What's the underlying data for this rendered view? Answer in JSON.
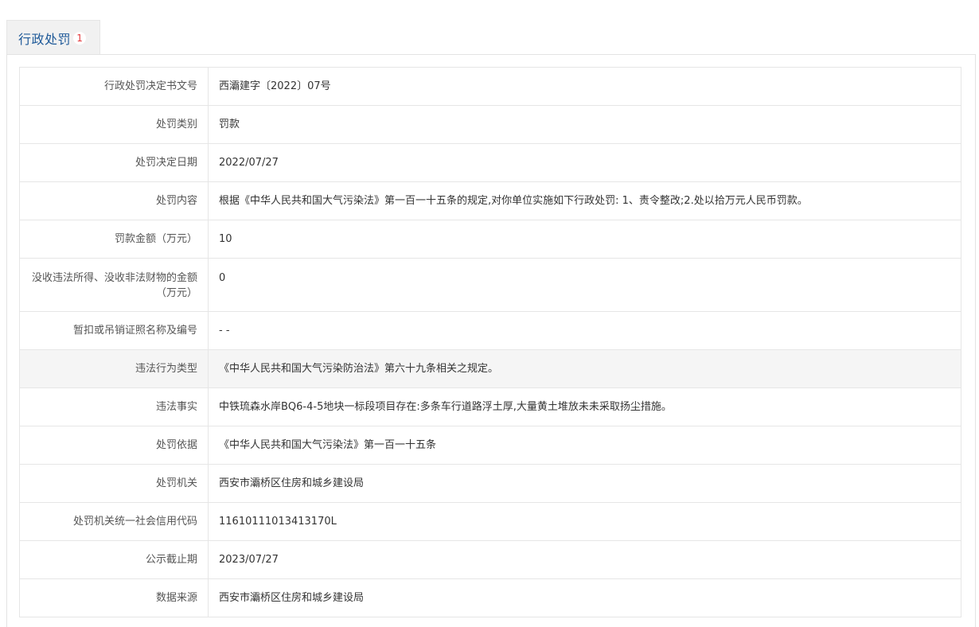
{
  "tab": {
    "label": "行政处罚",
    "count": "1"
  },
  "rows": [
    {
      "label": "行政处罚决定书文号",
      "value": "西灞建字〔2022〕07号"
    },
    {
      "label": "处罚类别",
      "value": "罚款"
    },
    {
      "label": "处罚决定日期",
      "value": "2022/07/27"
    },
    {
      "label": "处罚内容",
      "value": "根据《中华人民共和国大气污染法》第一百一十五条的规定,对你单位实施如下行政处罚: 1、责令整改;2.处以拾万元人民币罚款。"
    },
    {
      "label": "罚款金额（万元）",
      "value": "10"
    },
    {
      "label": "没收违法所得、没收非法财物的金额（万元）",
      "value": "0"
    },
    {
      "label": "暂扣或吊销证照名称及编号",
      "value": "- -"
    },
    {
      "label": "违法行为类型",
      "value": "《中华人民共和国大气污染防治法》第六十九条相关之规定。"
    },
    {
      "label": "违法事实",
      "value": "中铁琉森水岸BQ6-4-5地块一标段项目存在:多条车行道路浮土厚,大量黄土堆放未未采取扬尘措施。"
    },
    {
      "label": "处罚依据",
      "value": "《中华人民共和国大气污染法》第一百一十五条"
    },
    {
      "label": "处罚机关",
      "value": "西安市灞桥区住房和城乡建设局"
    },
    {
      "label": "处罚机关统一社会信用代码",
      "value": "11610111013413170L"
    },
    {
      "label": "公示截止期",
      "value": "2023/07/27"
    },
    {
      "label": "数据来源",
      "value": "西安市灞桥区住房和城乡建设局"
    }
  ],
  "colors": {
    "tab_text": "#1f5a99",
    "count_text": "#e4393c",
    "border": "#e6e6e6",
    "shaded_row": "#f5f5f5"
  }
}
